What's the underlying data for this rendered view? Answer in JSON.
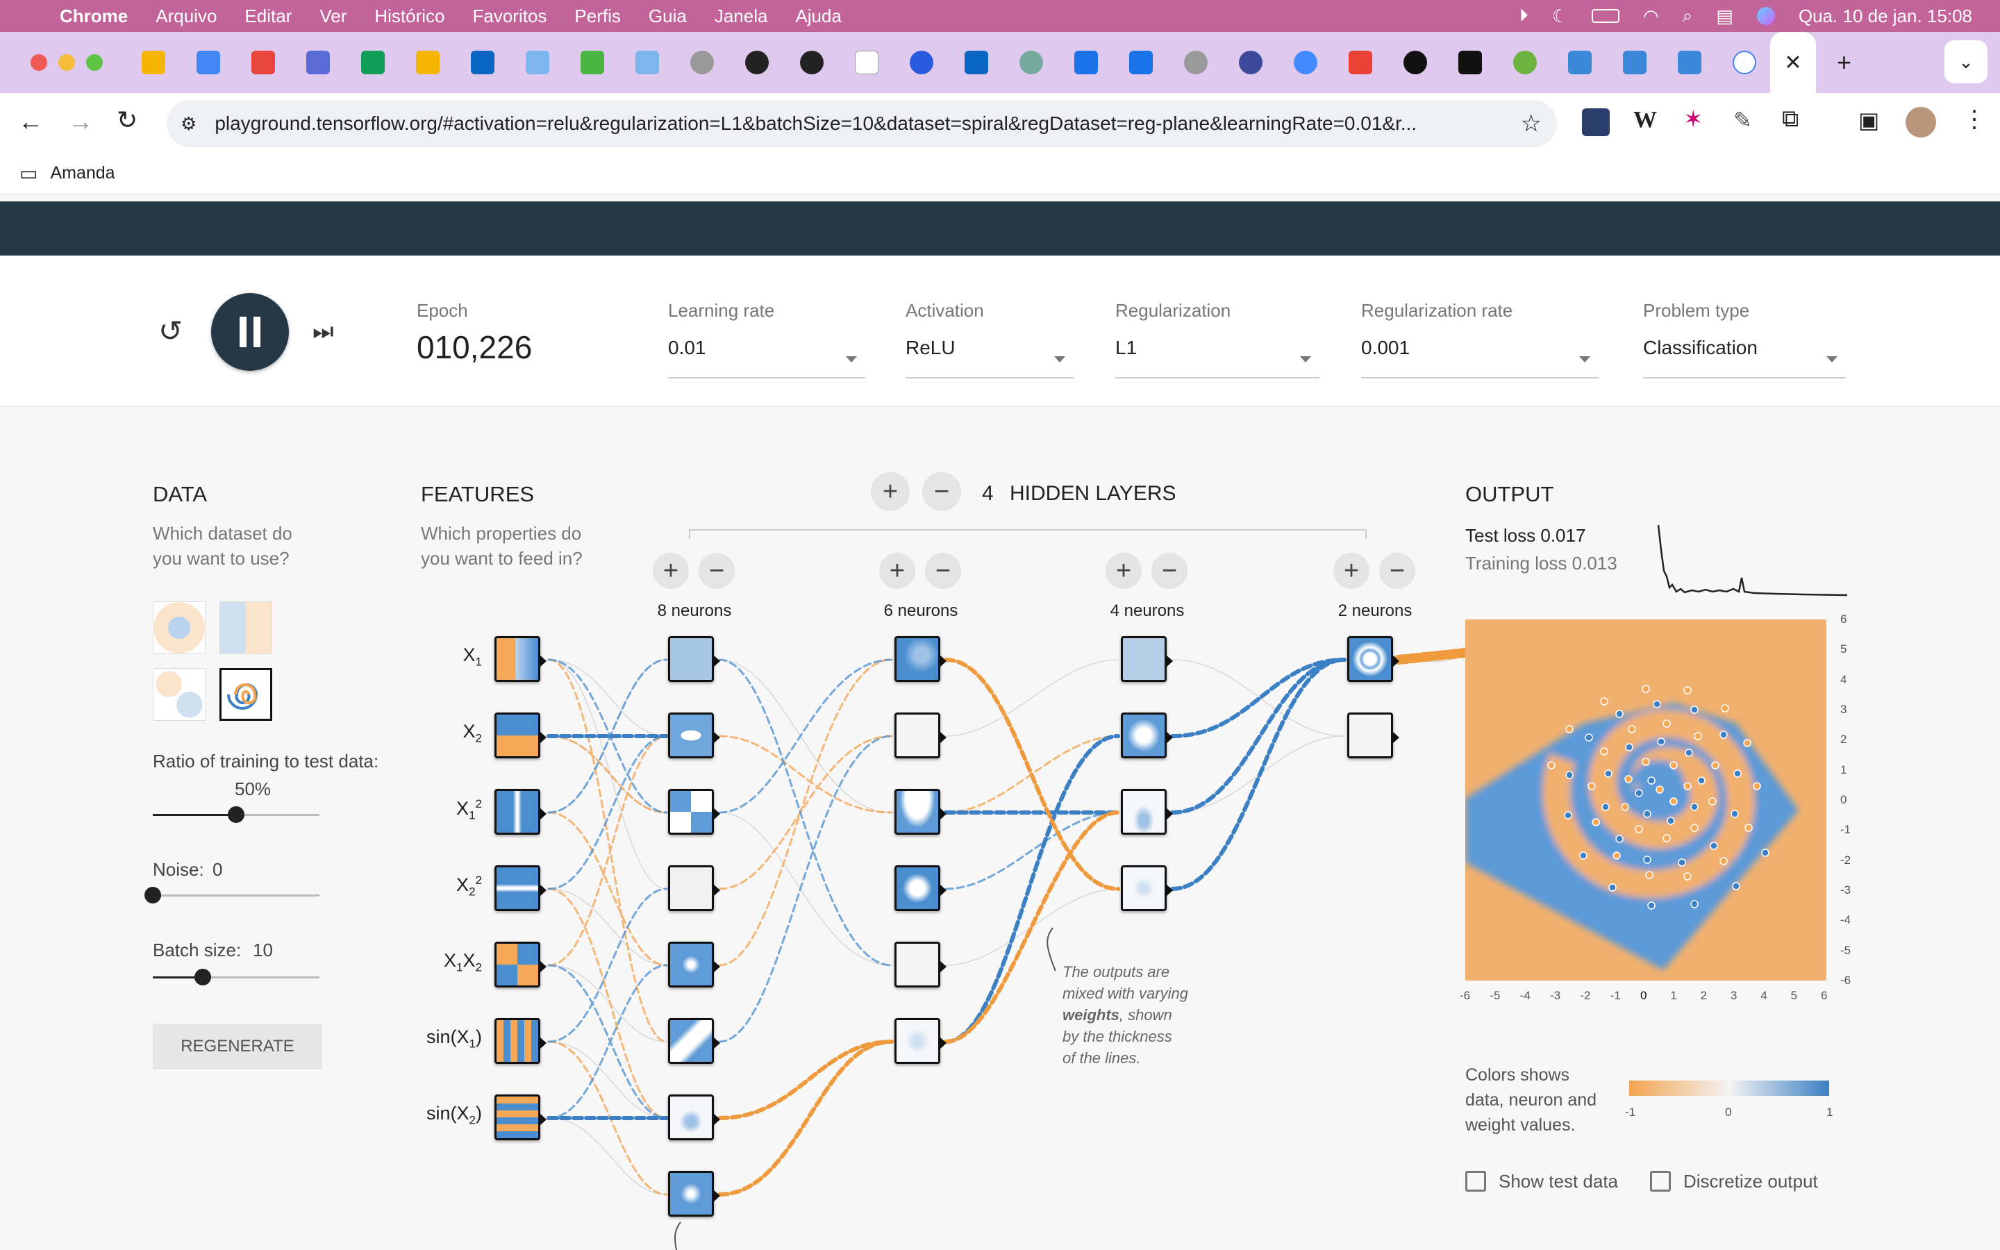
{
  "menubar": {
    "app": "Chrome",
    "items": [
      "Arquivo",
      "Editar",
      "Ver",
      "Histórico",
      "Favoritos",
      "Perfis",
      "Guia",
      "Janela",
      "Ajuda"
    ],
    "datetime": "Qua. 10 de jan.  15:08"
  },
  "browser": {
    "url": "playground.tensorflow.org/#activation=relu&regularization=L1&batchSize=10&dataset=spiral&regDataset=reg-plane&learningRate=0.01&r...",
    "bookmark_folder": "Amanda",
    "close_tab": "✕",
    "new_tab": "+"
  },
  "controls": {
    "epoch_label": "Epoch",
    "epoch_value": "010,226",
    "learning_rate": {
      "label": "Learning rate",
      "value": "0.01"
    },
    "activation": {
      "label": "Activation",
      "value": "ReLU"
    },
    "regularization": {
      "label": "Regularization",
      "value": "L1"
    },
    "regularization_rate": {
      "label": "Regularization rate",
      "value": "0.001"
    },
    "problem_type": {
      "label": "Problem type",
      "value": "Classification"
    }
  },
  "data": {
    "title": "DATA",
    "subtitle": "Which dataset do you want to use?",
    "ratio_label": "Ratio of training to test data:",
    "ratio_value": "50%",
    "ratio_fraction": 0.5,
    "noise_label": "Noise:",
    "noise_value": "0",
    "noise_fraction": 0,
    "batch_label": "Batch size:",
    "batch_value": "10",
    "batch_fraction": 0.3,
    "regenerate": "REGENERATE"
  },
  "features": {
    "title": "FEATURES",
    "subtitle": "Which properties do you want to feed in?",
    "items": [
      {
        "base": "X",
        "sub": "1",
        "sup": ""
      },
      {
        "base": "X",
        "sub": "2",
        "sup": ""
      },
      {
        "base": "X",
        "sub": "1",
        "sup": "2"
      },
      {
        "base": "X",
        "sub": "2",
        "sup": "2"
      },
      {
        "base": "X",
        "sub": "1",
        "mid": "X",
        "sub2": "2",
        "sup": ""
      },
      {
        "base": "sin(X",
        "sub": "1",
        "tail": ")"
      },
      {
        "base": "sin(X",
        "sub": "2",
        "tail": ")"
      }
    ]
  },
  "hidden": {
    "count": "4",
    "title": "HIDDEN LAYERS",
    "layers": [
      "8 neurons",
      "6 neurons",
      "4 neurons",
      "2 neurons"
    ],
    "plus": "+",
    "minus": "−"
  },
  "annotation": {
    "line1": "The outputs are",
    "line2": "mixed with varying",
    "bold": "weights",
    "line3": ", shown",
    "line4": "by the thickness",
    "line5": "of the lines."
  },
  "output": {
    "title": "OUTPUT",
    "test_loss": "Test loss 0.017",
    "training_loss": "Training loss 0.013",
    "yticks": [
      "6",
      "5",
      "4",
      "3",
      "2",
      "1",
      "0",
      "-1",
      "-2",
      "-3",
      "-4",
      "-5",
      "-6"
    ],
    "xticks": [
      "-6",
      "-5",
      "-4",
      "-3",
      "-2",
      "-1",
      "0",
      "1",
      "2",
      "3",
      "4",
      "5",
      "6"
    ],
    "legend_text": "Colors shows data, neuron and weight values.",
    "legend_min": "-1",
    "legend_mid": "0",
    "legend_max": "1",
    "show_test": "Show test data",
    "discretize": "Discretize output"
  },
  "colors": {
    "orange": "#f5a857",
    "blue": "#4a8ed0",
    "dark": "#263746"
  }
}
